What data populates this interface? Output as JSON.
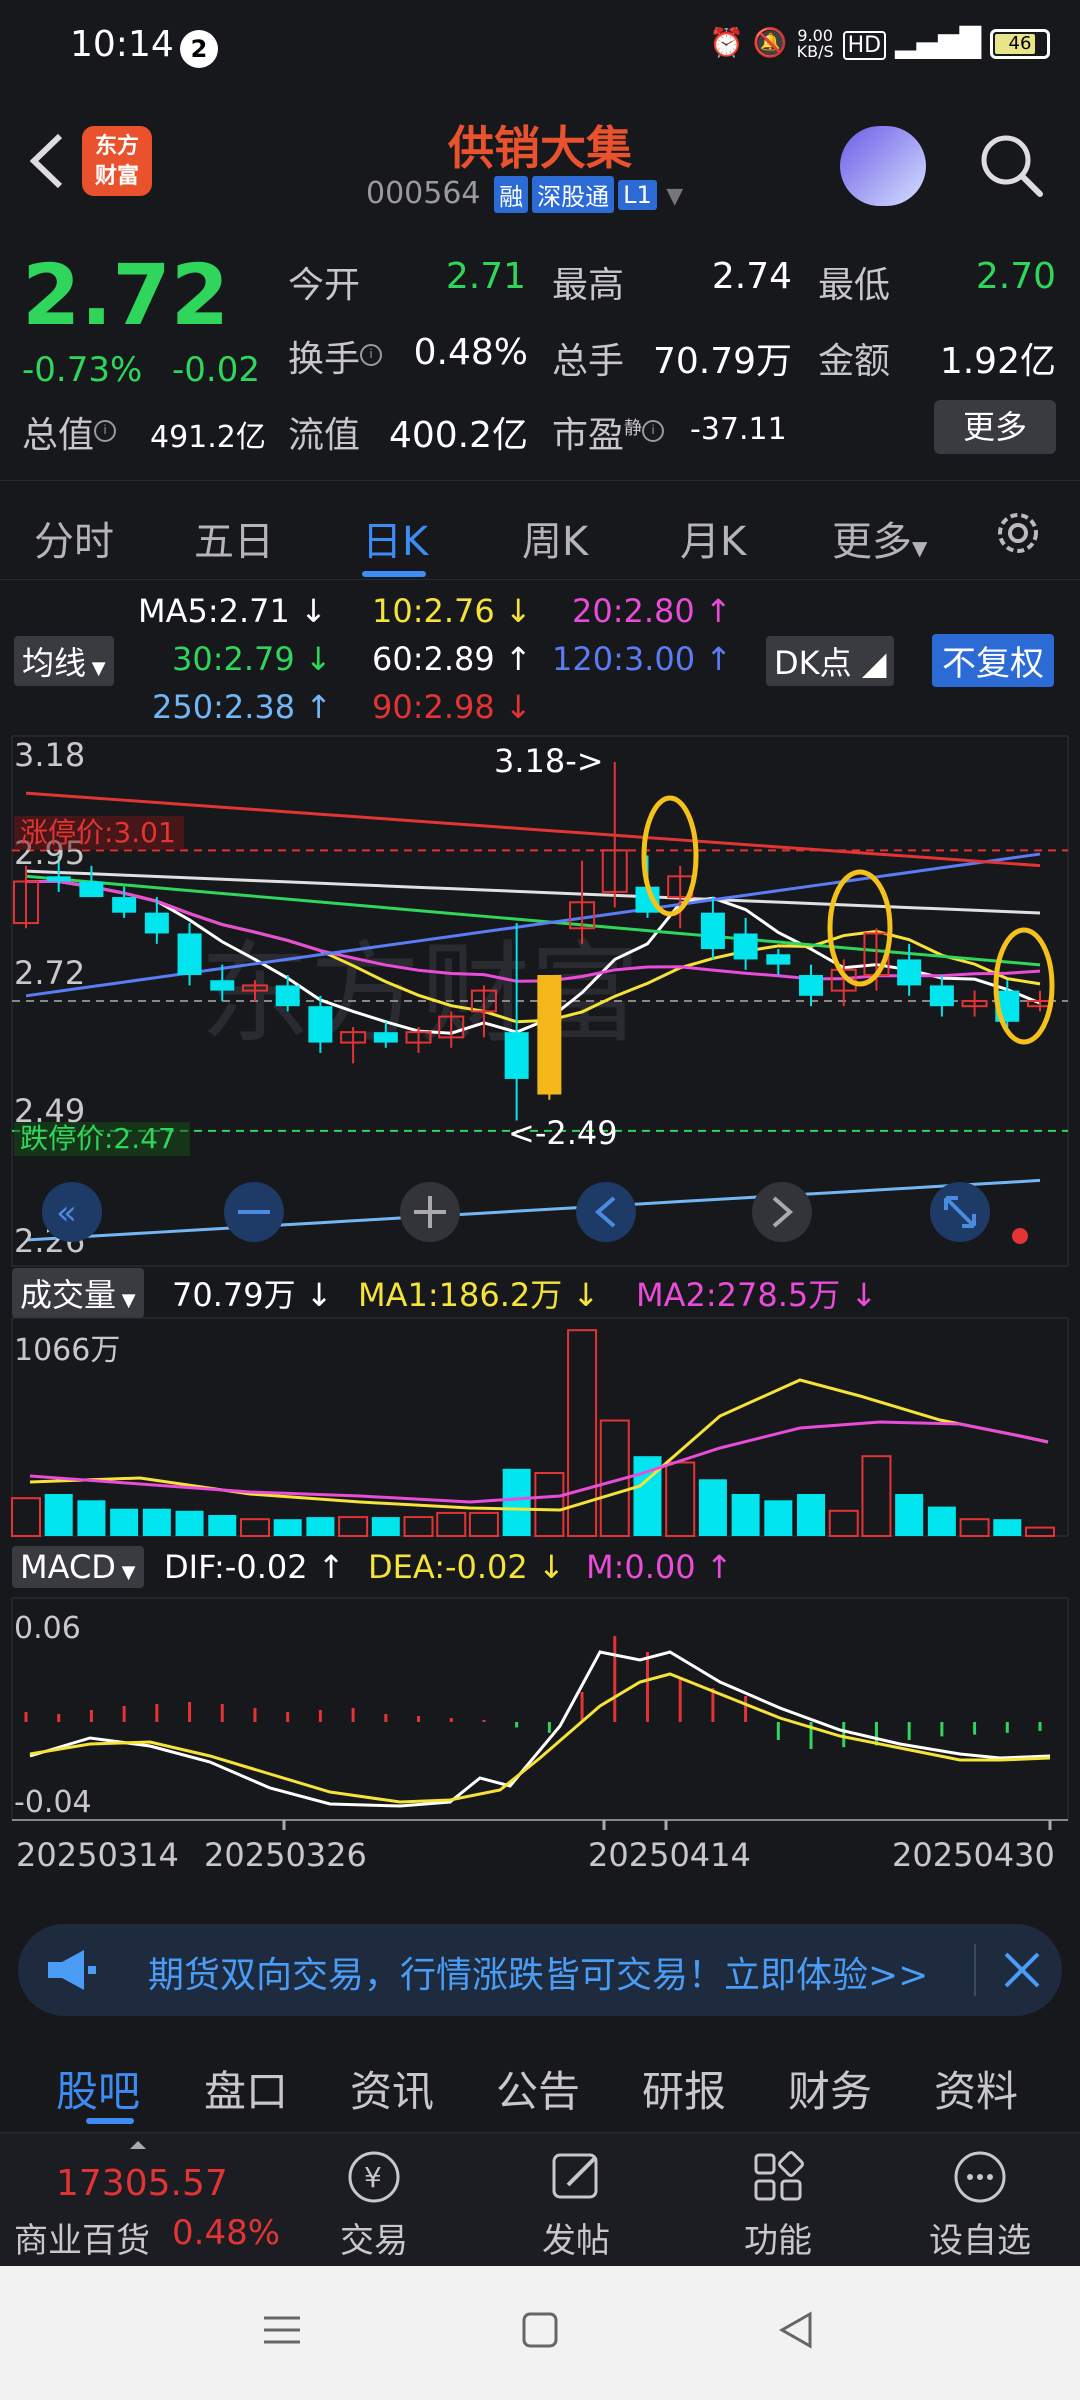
{
  "status_bar": {
    "time": "10:14",
    "notification_count": "2",
    "net_speed": "9.00\nKB/S",
    "battery": "46"
  },
  "header": {
    "stock_name": "供销大集",
    "stock_code": "000564",
    "tags": [
      "融",
      "深股通",
      "L1"
    ],
    "logo_text": "东方\n财富"
  },
  "quote": {
    "price": "2.72",
    "change_pct": "-0.73%",
    "change": "-0.02",
    "fields": {
      "open_label": "今开",
      "open": "2.71",
      "high_label": "最高",
      "high": "2.74",
      "low_label": "最低",
      "low": "2.70",
      "turnover_label": "换手",
      "turnover": "0.48%",
      "volume_label": "总手",
      "volume": "70.79万",
      "amount_label": "金额",
      "amount": "1.92亿",
      "mktcap_label": "总值",
      "mktcap": "491.2亿",
      "float_label": "流值",
      "float": "400.2亿",
      "pe_label": "市盈",
      "pe_sup": "静",
      "pe": "-37.11"
    },
    "more_label": "更多"
  },
  "period_tabs": [
    "分时",
    "五日",
    "日K",
    "周K",
    "月K",
    "更多"
  ],
  "active_period": "日K",
  "ma_legend": {
    "selector": "均线",
    "ma5": "MA5:2.71",
    "ma10": "10:2.76",
    "ma20": "20:2.80",
    "ma30": "30:2.79",
    "ma60": "60:2.89",
    "ma120": "120:3.00",
    "ma250": "250:2.38",
    "ma90": "90:2.98",
    "dk_label": "DK点",
    "adjust_label": "不复权"
  },
  "kline": {
    "y_labels": [
      "3.18",
      "2.95",
      "2.72",
      "2.49",
      "2.26"
    ],
    "limit_up_label": "涨停价:3.01",
    "limit_down_label": "跌停价:2.47",
    "high_marker": "3.18->",
    "low_marker": "<-2.49",
    "watermark": "东方财富"
  },
  "volume_panel": {
    "selector": "成交量",
    "vol": "70.79万",
    "ma1": "MA1:186.2万",
    "ma2": "MA2:278.5万",
    "max_label": "1066万"
  },
  "macd_panel": {
    "selector": "MACD",
    "dif": "DIF:-0.02",
    "dea": "DEA:-0.02",
    "m": "M:0.00",
    "top_label": "0.06",
    "bottom_label": "-0.04"
  },
  "dates": [
    "20250314",
    "20250326",
    "20250414",
    "20250430"
  ],
  "ad": {
    "text": "期货双向交易，行情涨跌皆可交易！立即体验>>"
  },
  "bottom_tabs": [
    "股吧",
    "盘口",
    "资讯",
    "公告",
    "研报",
    "财务",
    "资料"
  ],
  "index_widget": {
    "value": "17305.57",
    "name": "商业百货",
    "pct": "0.48%"
  },
  "actions": [
    "交易",
    "发帖",
    "功能",
    "设自选"
  ],
  "colors": {
    "up": "#e23434",
    "down": "#00e5ee",
    "accent": "#3d8bf5",
    "brand": "#e9522d"
  },
  "chart_data": {
    "type": "candlestick",
    "y_axis_labels": [
      3.18,
      2.95,
      2.72,
      2.49,
      2.26
    ],
    "x_labels": [
      "20250314",
      "20250326",
      "20250414",
      "20250430"
    ],
    "candles": [
      {
        "o": 2.87,
        "h": 2.98,
        "l": 2.86,
        "c": 2.95
      },
      {
        "o": 2.96,
        "h": 3.0,
        "l": 2.93,
        "c": 2.95
      },
      {
        "o": 2.95,
        "h": 2.98,
        "l": 2.93,
        "c": 2.92
      },
      {
        "o": 2.92,
        "h": 2.94,
        "l": 2.88,
        "c": 2.89
      },
      {
        "o": 2.89,
        "h": 2.92,
        "l": 2.83,
        "c": 2.85
      },
      {
        "o": 2.85,
        "h": 2.87,
        "l": 2.75,
        "c": 2.77
      },
      {
        "o": 2.76,
        "h": 2.79,
        "l": 2.72,
        "c": 2.74
      },
      {
        "o": 2.74,
        "h": 2.76,
        "l": 2.72,
        "c": 2.75
      },
      {
        "o": 2.75,
        "h": 2.77,
        "l": 2.7,
        "c": 2.71
      },
      {
        "o": 2.71,
        "h": 2.73,
        "l": 2.62,
        "c": 2.64
      },
      {
        "o": 2.64,
        "h": 2.67,
        "l": 2.6,
        "c": 2.66
      },
      {
        "o": 2.66,
        "h": 2.68,
        "l": 2.63,
        "c": 2.64
      },
      {
        "o": 2.64,
        "h": 2.67,
        "l": 2.62,
        "c": 2.66
      },
      {
        "o": 2.65,
        "h": 2.7,
        "l": 2.63,
        "c": 2.69
      },
      {
        "o": 2.7,
        "h": 2.75,
        "l": 2.65,
        "c": 2.74
      },
      {
        "o": 2.66,
        "h": 2.87,
        "l": 2.49,
        "c": 2.57
      },
      {
        "o": 2.54,
        "h": 2.77,
        "l": 2.53,
        "c": 2.77
      },
      {
        "o": 2.86,
        "h": 2.99,
        "l": 2.83,
        "c": 2.91
      },
      {
        "o": 2.93,
        "h": 3.18,
        "l": 2.9,
        "c": 3.01
      },
      {
        "o": 2.94,
        "h": 3.0,
        "l": 2.88,
        "c": 2.89
      },
      {
        "o": 2.92,
        "h": 2.98,
        "l": 2.86,
        "c": 2.96
      },
      {
        "o": 2.89,
        "h": 2.92,
        "l": 2.8,
        "c": 2.82
      },
      {
        "o": 2.85,
        "h": 2.88,
        "l": 2.78,
        "c": 2.8
      },
      {
        "o": 2.81,
        "h": 2.82,
        "l": 2.77,
        "c": 2.79
      },
      {
        "o": 2.77,
        "h": 2.79,
        "l": 2.71,
        "c": 2.73
      },
      {
        "o": 2.74,
        "h": 2.8,
        "l": 2.71,
        "c": 2.78
      },
      {
        "o": 2.77,
        "h": 2.86,
        "l": 2.74,
        "c": 2.85
      },
      {
        "o": 2.8,
        "h": 2.83,
        "l": 2.73,
        "c": 2.75
      },
      {
        "o": 2.75,
        "h": 2.77,
        "l": 2.69,
        "c": 2.71
      },
      {
        "o": 2.71,
        "h": 2.74,
        "l": 2.69,
        "c": 2.72
      },
      {
        "o": 2.74,
        "h": 2.76,
        "l": 2.67,
        "c": 2.68
      },
      {
        "o": 2.71,
        "h": 2.74,
        "l": 2.7,
        "c": 2.72
      }
    ]
  }
}
